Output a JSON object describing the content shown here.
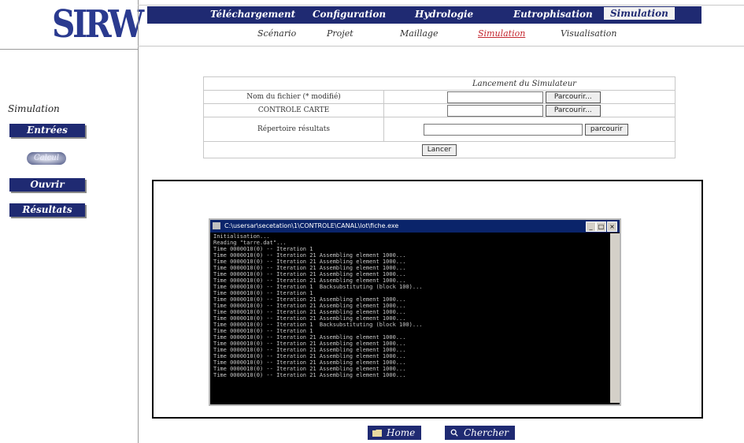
{
  "logo": {
    "text": "SIRW"
  },
  "menu": {
    "items": [
      {
        "label": "Téléchargement"
      },
      {
        "label": "Configuration"
      },
      {
        "label": "Hydrologie"
      },
      {
        "label": "Eutrophisation"
      },
      {
        "label": "Simulation"
      }
    ]
  },
  "submenu": {
    "items": [
      {
        "label": "Scénario"
      },
      {
        "label": "Projet"
      },
      {
        "label": "Maillage"
      },
      {
        "label": "Simulation"
      },
      {
        "label": "Visualisation"
      }
    ]
  },
  "sidebar": {
    "title": "Simulation",
    "buttons": [
      {
        "label": "Entrées"
      },
      {
        "label": "Calcul"
      },
      {
        "label": "Ouvrir"
      },
      {
        "label": "Résultats"
      }
    ]
  },
  "form": {
    "header": "Lancement du Simulateur",
    "file_label": "Nom du fichier (* modifié)",
    "card_label": "CONTROLE CARTE",
    "dir_label": "Répertoire résultats",
    "browse_label": "Parcourir...",
    "browse2_label": "parcourir",
    "launch_label": "Lancer"
  },
  "console": {
    "title": "C:\\usersar\\secetation\\1\\CONTROLE\\CANAL\\lot\\fiche.exe",
    "lines": [
      "Initialisation...",
      "Reading \"tarre.dat\"...",
      "Time 0000010(0) -- Iteration 1",
      "Time 0000010(0) -- Iteration 21 Assembling element 1000...",
      "Time 0000010(0) -- Iteration 21 Assembling element 1000...",
      "Time 0000010(0) -- Iteration 21 Assembling element 1000...",
      "Time 0000010(0) -- Iteration 21 Assembling element 1000...",
      "Time 0000010(0) -- Iteration 21 Assembling element 1000...",
      "Time 0000010(0) -- Iteration 1  Backsubstituting (block 100)...",
      "Time 0000010(0) -- Iteration 1",
      "Time 0000010(0) -- Iteration 21 Assembling element 1000...",
      "Time 0000010(0) -- Iteration 21 Assembling element 1000...",
      "Time 0000010(0) -- Iteration 21 Assembling element 1000...",
      "Time 0000010(0) -- Iteration 21 Assembling element 1000...",
      "Time 0000010(0) -- Iteration 1  Backsubstituting (block 100)...",
      "Time 0000010(0) -- Iteration 1",
      "Time 0000010(0) -- Iteration 21 Assembling element 1000...",
      "Time 0000010(0) -- Iteration 21 Assembling element 1000...",
      "Time 0000010(0) -- Iteration 21 Assembling element 1000...",
      "Time 0000010(0) -- Iteration 21 Assembling element 1000...",
      "Time 0000010(0) -- Iteration 21 Assembling element 1000...",
      "Time 0000010(0) -- Iteration 21 Assembling element 1000...",
      "Time 0000010(0) -- Iteration 21 Assembling element 1000..."
    ]
  },
  "footer": {
    "home_label": "Home",
    "search_label": "Chercher"
  },
  "colors": {
    "navy": "#1f2a72",
    "active_sub": "#c4262e"
  }
}
